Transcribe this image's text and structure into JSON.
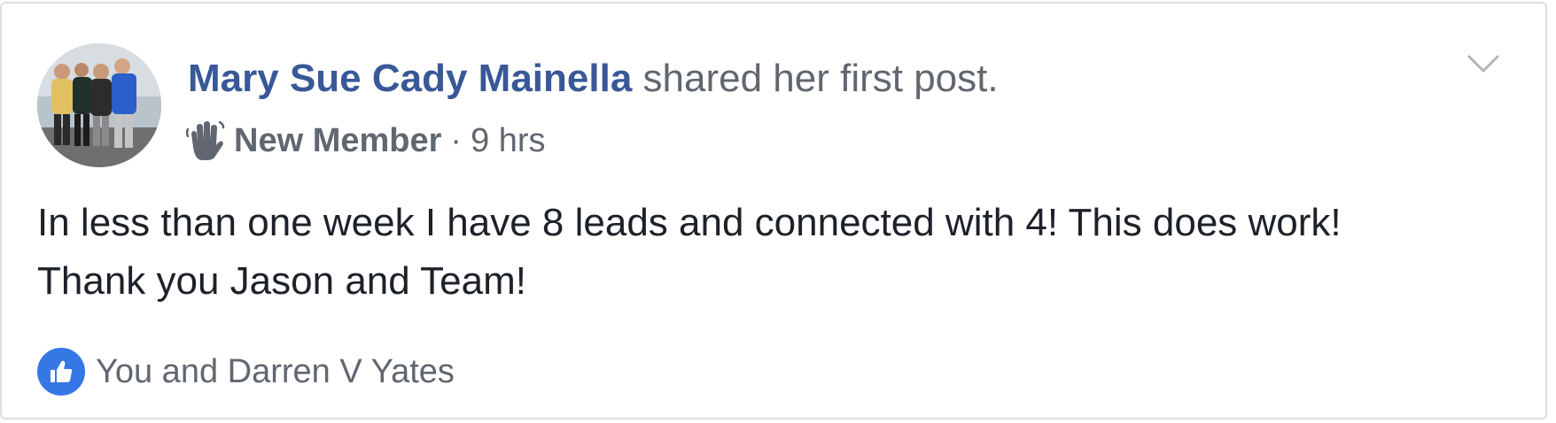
{
  "post": {
    "author": "Mary Sue Cady Mainella",
    "action": " shared her first post.",
    "badge_icon": "wave-hand-icon",
    "badge_label": "New Member",
    "separator": "·",
    "timestamp": "9 hrs",
    "menu_icon": "chevron-down-icon",
    "body_lines": [
      "In less than one week I have 8 leads and connected with 4! This does work!",
      "Thank you Jason and Team!"
    ],
    "reaction_icon": "like-icon",
    "reaction_text": "You and Darren V Yates"
  },
  "colors": {
    "author_link": "#385898",
    "secondary_text": "#616770",
    "body_text": "#1d2129",
    "like_blue": "#3578e5",
    "card_border": "#dddfe2"
  }
}
